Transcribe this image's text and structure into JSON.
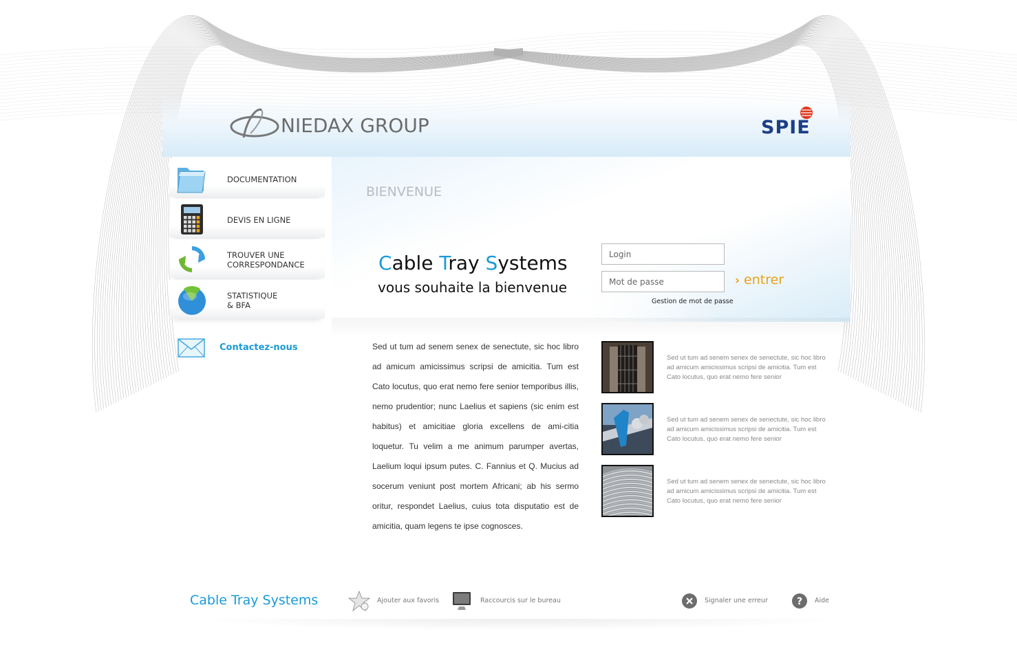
{
  "header": {
    "brand_left": "NIEDAX GROUP",
    "brand_right": "SPIE"
  },
  "nav": {
    "items": [
      {
        "label": "DOCUMENTATION",
        "icon": "folder-icon"
      },
      {
        "label": "DEVIS EN LIGNE",
        "icon": "calculator-icon"
      },
      {
        "label_line1": "TROUVER UNE",
        "label_line2": "CORRESPONDANCE",
        "icon": "refresh-arrows-icon"
      },
      {
        "label_line1": "STATISTIQUE",
        "label_line2": "& BFA",
        "icon": "pie-chart-icon"
      }
    ],
    "contact": {
      "label": "Contactez-nous",
      "icon": "envelope-icon"
    }
  },
  "main": {
    "welcome": "BIENVENUE",
    "title_parts": [
      "C",
      "able ",
      "T",
      "ray ",
      "S",
      "ystems"
    ],
    "subtitle": "vous souhaite la bienvenue",
    "login_placeholder": "Login",
    "password_placeholder": "Mot de passe",
    "enter_label": "entrer",
    "password_help": "Gestion de mot de passe"
  },
  "content": {
    "paragraph": "Sed ut tum ad senem senex de senectute, sic hoc libro ad amicum amicissimus scripsi de amicitia. Tum est Cato locutus, quo erat nemo fere senior temporibus illis, nemo prudentior; nunc Laelius et sapiens (sic enim est habitus) et amicitiae gloria excellens de ami-citia loquetur. Tu velim a me animum parumper avertas, Laelium loqui ipsum putes. C. Fannius et Q. Mucius ad socerum veniunt post mortem Africani; ab his sermo oritur, respondet Laelius, cuius tota disputatio est de amicitia, quam legens te ipse cognosces.",
    "thumbs": [
      {
        "text": "Sed ut tum ad senem senex de senectute, sic hoc libro ad amicum amicissimus scripsi de amicitia. Tum est Cato locutus, quo erat nemo fere senior"
      },
      {
        "text": "Sed ut tum ad senem senex de senectute, sic hoc libro ad amicum amicissimus scripsi de amicitia. Tum est Cato locutus, quo erat nemo fere senior"
      },
      {
        "text": "Sed ut tum ad senem senex de senectute, sic hoc libro ad amicum amicissimus scripsi de amicitia. Tum est Cato locutus, quo erat nemo fere senior"
      }
    ]
  },
  "footer": {
    "brand": "Cable Tray Systems",
    "favorites": "Ajouter aux favoris",
    "shortcut": "Raccourcis sur le bureau",
    "report": "Signaler une erreur",
    "help": "Aide"
  },
  "colors": {
    "accent_blue": "#1a9ad6",
    "enter_orange": "#e8a217",
    "spie_navy": "#1c3f85",
    "spie_red": "#e0391e"
  }
}
